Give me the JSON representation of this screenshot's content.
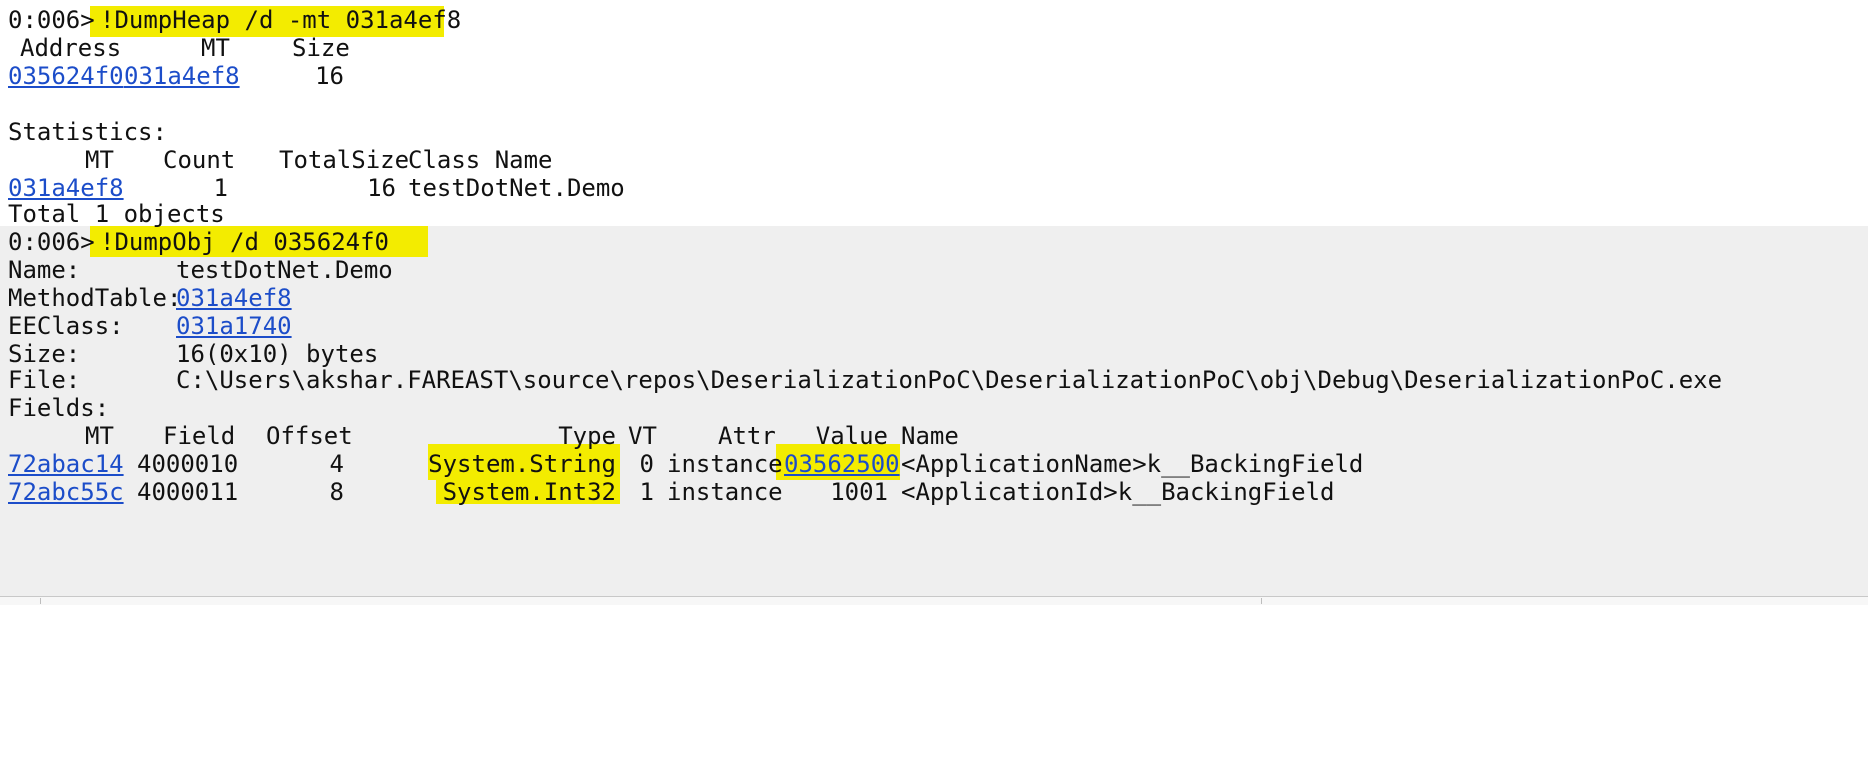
{
  "prompt": "0:006>",
  "cmd1": {
    "command": "!DumpHeap /d -mt 031a4ef8",
    "headers": {
      "address": "Address",
      "mt": "MT",
      "size": "Size"
    },
    "row": {
      "address": "035624f0",
      "mt": "031a4ef8",
      "size": "16"
    },
    "statistics_label": "Statistics:",
    "stats_headers": {
      "mt": "MT",
      "count": "Count",
      "totalsize": "TotalSize",
      "classname": "Class Name"
    },
    "stats_row": {
      "mt": "031a4ef8",
      "count": "1",
      "totalsize": "16",
      "classname": "testDotNet.Demo"
    },
    "total": "Total 1 objects"
  },
  "cmd2": {
    "command": "!DumpObj /d 035624f0",
    "name_label": "Name:",
    "name_value": "testDotNet.Demo",
    "mt_label": "MethodTable:",
    "mt_value": "031a4ef8",
    "eeclass_label": "EEClass:",
    "eeclass_value": "031a1740",
    "size_label": "Size:",
    "size_value": "16(0x10) bytes",
    "file_label": "File:",
    "file_value": "C:\\Users\\akshar.FAREAST\\source\\repos\\DeserializationPoC\\DeserializationPoC\\obj\\Debug\\DeserializationPoC.exe",
    "fields_label": "Fields:",
    "fields_headers": {
      "mt": "MT",
      "field": "Field",
      "offset": "Offset",
      "type": "Type",
      "vt": "VT",
      "attr": "Attr",
      "value": "Value",
      "name": "Name"
    },
    "fields": [
      {
        "mt": "72abac14",
        "field": "4000010",
        "offset": "4",
        "type": "System.String",
        "vt": "0",
        "attr": "instance",
        "value": "03562500",
        "name": "<ApplicationName>k__BackingField"
      },
      {
        "mt": "72abc55c",
        "field": "4000011",
        "offset": "8",
        "type": "System.Int32",
        "vt": "1",
        "attr": "instance",
        "value": "1001",
        "name": "<ApplicationId>k__BackingField"
      }
    ]
  },
  "colors": {
    "highlight": "#f3ec00",
    "link": "#1c4dc9",
    "output_background": "#efefef"
  }
}
